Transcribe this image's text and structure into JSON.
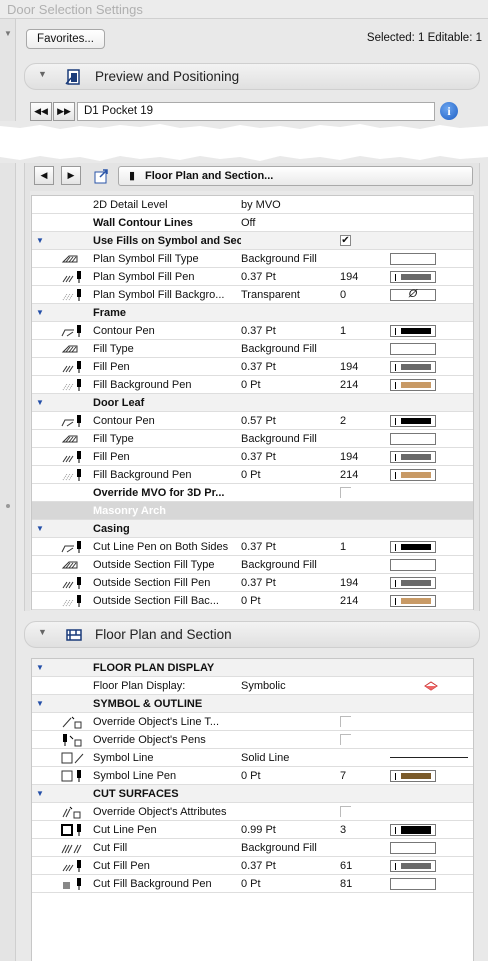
{
  "window": {
    "title": "Door Selection Settings"
  },
  "toolbar": {
    "favorites_label": "Favorites...",
    "selection_info": "Selected: 1 Editable: 1"
  },
  "preview_panel": {
    "title": "Preview and Positioning",
    "door_name": "D1 Pocket 19",
    "info_label": "i"
  },
  "settings_nav": {
    "page_label": "Floor Plan and Section..."
  },
  "params": [
    {
      "kind": "item",
      "icon": "",
      "name": "2D Detail Level",
      "value": "by MVO",
      "num": "",
      "bold": false
    },
    {
      "kind": "item",
      "icon": "",
      "name": "Wall Contour Lines",
      "value": "Off",
      "num": "",
      "bold": true
    },
    {
      "kind": "group",
      "name": "Use Fills on Symbol and Section",
      "check": "checked"
    },
    {
      "kind": "item",
      "icon": "fill-type-icon",
      "name": "Plan Symbol Fill Type",
      "value": "Background Fill",
      "num": "",
      "swatch": "empty"
    },
    {
      "kind": "item",
      "icon": "fill-pen-icon",
      "name": "Plan Symbol Fill Pen",
      "value": "0.37 Pt",
      "num": "194",
      "swatch": "#6a6a6a"
    },
    {
      "kind": "item",
      "icon": "fill-background-pen-icon",
      "name": "Plan Symbol Fill Backgro...",
      "value": "Transparent",
      "num": "0",
      "swatch": "none"
    },
    {
      "kind": "group",
      "name": "Frame"
    },
    {
      "kind": "item",
      "icon": "contour-pen-icon",
      "name": "Contour Pen",
      "value": "0.37 Pt",
      "num": "1",
      "swatch": "#000000"
    },
    {
      "kind": "item",
      "icon": "fill-type-icon",
      "name": "Fill Type",
      "value": "Background Fill",
      "num": "",
      "swatch": "empty"
    },
    {
      "kind": "item",
      "icon": "fill-pen-icon",
      "name": "Fill Pen",
      "value": "0.37 Pt",
      "num": "194",
      "swatch": "#6a6a6a"
    },
    {
      "kind": "item",
      "icon": "fill-background-pen-icon",
      "name": "Fill Background Pen",
      "value": "0 Pt",
      "num": "214",
      "swatch": "#c89a66"
    },
    {
      "kind": "group",
      "name": "Door Leaf"
    },
    {
      "kind": "item",
      "icon": "contour-pen-icon",
      "name": "Contour Pen",
      "value": "0.57 Pt",
      "num": "2",
      "swatch": "#000000"
    },
    {
      "kind": "item",
      "icon": "fill-type-icon",
      "name": "Fill Type",
      "value": "Background Fill",
      "num": "",
      "swatch": "empty"
    },
    {
      "kind": "item",
      "icon": "fill-pen-icon",
      "name": "Fill Pen",
      "value": "0.37 Pt",
      "num": "194",
      "swatch": "#6a6a6a"
    },
    {
      "kind": "item",
      "icon": "fill-background-pen-icon",
      "name": "Fill Background Pen",
      "value": "0 Pt",
      "num": "214",
      "swatch": "#c89a66"
    },
    {
      "kind": "item",
      "icon": "",
      "name": "Override MVO for 3D Pr...",
      "value": "",
      "num": "",
      "bold": true,
      "check": "disabled"
    },
    {
      "kind": "gray",
      "name": "Masonry Arch"
    },
    {
      "kind": "group",
      "name": "Casing"
    },
    {
      "kind": "item",
      "icon": "contour-pen-icon",
      "name": "Cut Line Pen on Both Sides",
      "value": "0.37 Pt",
      "num": "1",
      "swatch": "#000000"
    },
    {
      "kind": "item",
      "icon": "fill-type-icon",
      "name": "Outside Section Fill Type",
      "value": "Background Fill",
      "num": "",
      "swatch": "empty"
    },
    {
      "kind": "item",
      "icon": "fill-pen-icon",
      "name": "Outside Section Fill Pen",
      "value": "0.37 Pt",
      "num": "194",
      "swatch": "#6a6a6a"
    },
    {
      "kind": "item",
      "icon": "fill-background-pen-icon",
      "name": "Outside Section Fill Bac...",
      "value": "0 Pt",
      "num": "214",
      "swatch": "#c89a66"
    }
  ],
  "floorplan_panel": {
    "title": "Floor Plan and Section"
  },
  "fp_params": [
    {
      "kind": "group",
      "name": "FLOOR PLAN DISPLAY"
    },
    {
      "kind": "item",
      "icon": "",
      "name": "Floor Plan Display:",
      "value": "Symbolic",
      "num": "",
      "fp": true
    },
    {
      "kind": "group",
      "name": "SYMBOL & OUTLINE"
    },
    {
      "kind": "item",
      "icon": "override-line-type-icon",
      "name": "Override Object's Line T...",
      "value": "",
      "num": "",
      "check": "disabled"
    },
    {
      "kind": "item",
      "icon": "override-pens-icon",
      "name": "Override Object's Pens",
      "value": "",
      "num": "",
      "check": "disabled"
    },
    {
      "kind": "item",
      "icon": "symbol-line-icon",
      "name": "Symbol Line",
      "value": "Solid Line",
      "num": "",
      "line": true
    },
    {
      "kind": "item",
      "icon": "symbol-line-pen-icon",
      "name": "Symbol Line Pen",
      "value": "0 Pt",
      "num": "7",
      "swatch": "#7a5a2a"
    },
    {
      "kind": "group",
      "name": "CUT SURFACES"
    },
    {
      "kind": "item",
      "icon": "override-attributes-icon",
      "name": "Override Object's Attributes",
      "value": "",
      "num": "",
      "check": "disabled"
    },
    {
      "kind": "item",
      "icon": "cut-line-pen-icon",
      "name": "Cut Line Pen",
      "value": "0.99 Pt",
      "num": "3",
      "swatch": "#000000",
      "thick": true
    },
    {
      "kind": "item",
      "icon": "cut-fill-icon",
      "name": "Cut Fill",
      "value": "Background Fill",
      "num": "",
      "swatch": "empty"
    },
    {
      "kind": "item",
      "icon": "cut-fill-pen-icon",
      "name": "Cut Fill Pen",
      "value": "0.37 Pt",
      "num": "61",
      "swatch": "#6a6a6a"
    },
    {
      "kind": "item",
      "icon": "cut-fill-background-pen-icon",
      "name": "Cut Fill Background Pen",
      "value": "0 Pt",
      "num": "81",
      "swatch": "empty"
    }
  ]
}
